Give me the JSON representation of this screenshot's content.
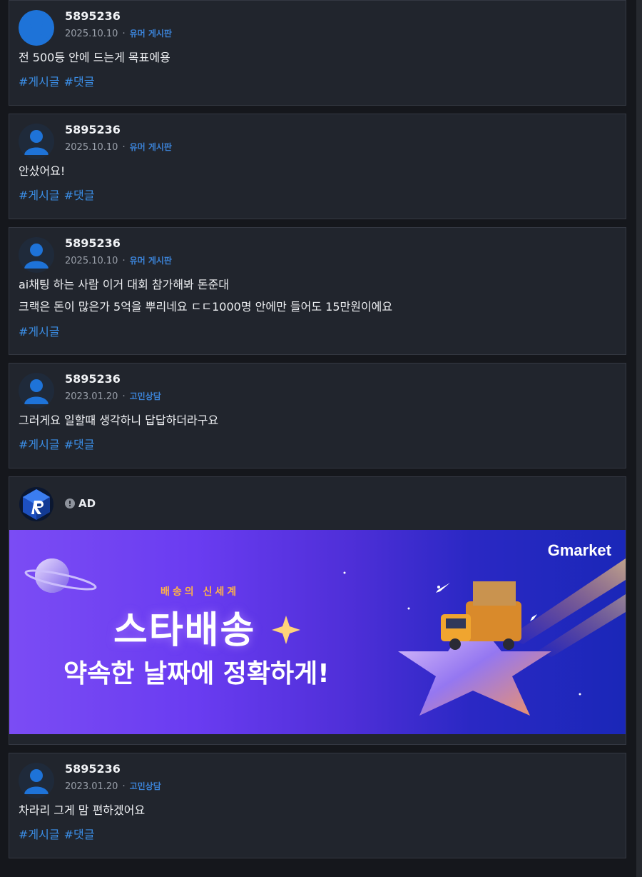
{
  "posts": [
    {
      "username": "5895236",
      "date": "2025.10.10",
      "board": "유머 게시판",
      "lines": [
        "전 500등 안에 드는게 목표에용"
      ],
      "tags": [
        "#게시글",
        "#댓글"
      ]
    },
    {
      "username": "5895236",
      "date": "2025.10.10",
      "board": "유머 게시판",
      "lines": [
        "안샀어요!"
      ],
      "tags": [
        "#게시글",
        "#댓글"
      ]
    },
    {
      "username": "5895236",
      "date": "2025.10.10",
      "board": "유머 게시판",
      "lines": [
        "ai채팅 하는 사람 이거 대회 참가해봐 돈준대",
        "크랙은 돈이 많은가 5억을 뿌리네요 ㄷㄷ1000명 안에만 들어도 15만원이에요"
      ],
      "tags": [
        "#게시글"
      ]
    },
    {
      "username": "5895236",
      "date": "2023.01.20",
      "board": "고민상담",
      "lines": [
        "그러게요 일할때 생각하니 답답하더라구요"
      ],
      "tags": [
        "#게시글",
        "#댓글"
      ]
    },
    {
      "username": "5895236",
      "date": "2023.01.20",
      "board": "고민상담",
      "lines": [
        "차라리 그게 맘 편하겠어요"
      ],
      "tags": [
        "#게시글",
        "#댓글"
      ]
    }
  ],
  "ad": {
    "info_icon": "!",
    "label": "AD",
    "brand": "Gmarket",
    "subtitle": "배송의 신세계",
    "headline": "스타배송",
    "tagline": "약속한 날짜에 정확하게!"
  },
  "colors": {
    "background": "#15171c",
    "card": "#21252d",
    "tag": "#3b8ee6",
    "board": "#3b82d6",
    "avatar": "#1e73d8"
  },
  "icons": {
    "avatar": "user-silhouette-icon",
    "ad_logo": "blue-cube-r-logo",
    "ad_info": "info-circle-icon"
  }
}
